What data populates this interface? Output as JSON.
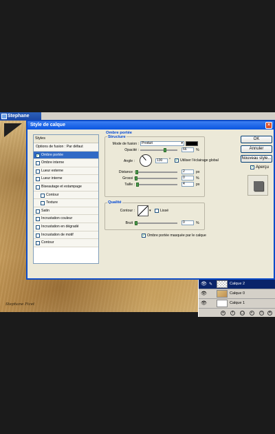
{
  "photo_window": {
    "title": "Stephane",
    "signature": "Stephane Ficet"
  },
  "layers": [
    {
      "name": "Calque 2",
      "selected": true,
      "thumb": "checker"
    },
    {
      "name": "Calque 0",
      "selected": false,
      "thumb": "wheat"
    },
    {
      "name": "Calque 1",
      "selected": false,
      "thumb": "blank"
    }
  ],
  "dialog": {
    "title": "Style de calque",
    "styles_list": {
      "header": "Styles",
      "items": [
        {
          "label": "Options de fusion : Par défaut",
          "checkbox": false,
          "checked": false,
          "selected": false,
          "sub": false
        },
        {
          "label": "Ombre portée",
          "checkbox": true,
          "checked": true,
          "selected": true,
          "sub": false
        },
        {
          "label": "Ombre interne",
          "checkbox": true,
          "checked": false,
          "selected": false,
          "sub": false
        },
        {
          "label": "Lueur externe",
          "checkbox": true,
          "checked": false,
          "selected": false,
          "sub": false
        },
        {
          "label": "Lueur interne",
          "checkbox": true,
          "checked": false,
          "selected": false,
          "sub": false
        },
        {
          "label": "Biseautage et estampage",
          "checkbox": true,
          "checked": false,
          "selected": false,
          "sub": false
        },
        {
          "label": "Contour",
          "checkbox": true,
          "checked": false,
          "selected": false,
          "sub": true
        },
        {
          "label": "Texture",
          "checkbox": true,
          "checked": false,
          "selected": false,
          "sub": true
        },
        {
          "label": "Satin",
          "checkbox": true,
          "checked": false,
          "selected": false,
          "sub": false
        },
        {
          "label": "Incrustation couleur",
          "checkbox": true,
          "checked": false,
          "selected": false,
          "sub": false
        },
        {
          "label": "Incrustation en dégradé",
          "checkbox": true,
          "checked": false,
          "selected": false,
          "sub": false
        },
        {
          "label": "Incrustation de motif",
          "checkbox": true,
          "checked": false,
          "selected": false,
          "sub": false
        },
        {
          "label": "Contour",
          "checkbox": true,
          "checked": false,
          "selected": false,
          "sub": false
        }
      ]
    },
    "section_title": "Ombre portée",
    "structure": {
      "title": "Structure",
      "blend_mode_label": "Mode de fusion :",
      "blend_mode_value": "Produit",
      "color": "#000000",
      "opacity_label": "Opacité :",
      "opacity_value": "66",
      "opacity_unit": "%",
      "opacity_fraction": 0.66,
      "angle_label": "Angle :",
      "angle_value": "130",
      "angle_unit": "°",
      "global_light_label": "Utiliser l'éclairage global",
      "global_light_checked": true,
      "distance_label": "Distance :",
      "distance_value": "2",
      "distance_unit": "px",
      "distance_fraction": 0.02,
      "spread_label": "Grossi :",
      "spread_value": "0",
      "spread_unit": "%",
      "spread_fraction": 0,
      "size_label": "Taille :",
      "size_value": "4",
      "size_unit": "px",
      "size_fraction": 0.03
    },
    "quality": {
      "title": "Qualité",
      "contour_label": "Contour :",
      "smooth_label": "Lissé",
      "smooth_checked": false,
      "noise_label": "Bruit :",
      "noise_value": "0",
      "noise_unit": "%",
      "noise_fraction": 0
    },
    "knockout_label": "Ombre portée masquée par le calque",
    "knockout_checked": true,
    "buttons": {
      "ok": "OK",
      "cancel": "Annuler",
      "new_style": "Nouveau style..."
    },
    "preview_label": "Aperçu",
    "preview_checked": true
  }
}
